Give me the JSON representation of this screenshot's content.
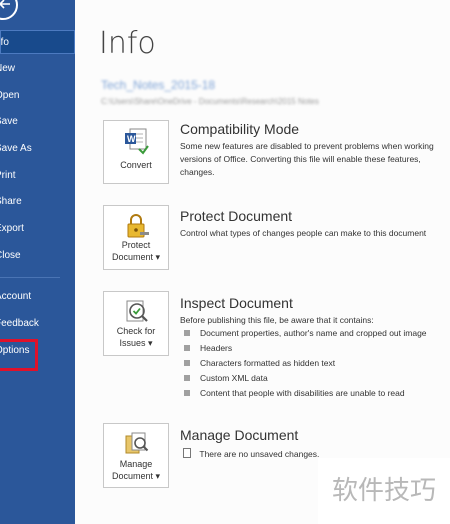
{
  "sidebar": {
    "items": [
      {
        "label": "nfo"
      },
      {
        "label": "New"
      },
      {
        "label": "Open"
      },
      {
        "label": "Save"
      },
      {
        "label": "Save As"
      },
      {
        "label": "Print"
      },
      {
        "label": "Share"
      },
      {
        "label": "Export"
      },
      {
        "label": "Close"
      },
      {
        "label": "Account"
      },
      {
        "label": "Feedback"
      },
      {
        "label": "Options"
      }
    ]
  },
  "main": {
    "title": "Info",
    "file_name": "Tech_Notes_2015-18",
    "file_path": "C:\\Users\\Share\\OneDrive - Documents\\Research\\2015 Notes",
    "sections": {
      "compatibility": {
        "button_label": "Convert",
        "title": "Compatibility Mode",
        "text_lines": [
          "Some new features are disabled to prevent problems when working",
          "versions of Office. Converting this file will enable these features,",
          "changes."
        ]
      },
      "protect": {
        "button_line1": "Protect",
        "button_line2": "Document",
        "title": "Protect Document",
        "text": "Control what types of changes people can make to this document"
      },
      "inspect": {
        "button_line1": "Check for",
        "button_line2": "Issues",
        "title": "Inspect Document",
        "intro": "Before publishing this file, be aware that it contains:",
        "bullets": [
          "Document properties, author's name and cropped out image",
          "Headers",
          "Characters formatted as hidden text",
          "Custom XML data",
          "Content that people with disabilities are unable to read"
        ]
      },
      "manage": {
        "button_line1": "Manage",
        "button_line2": "Document",
        "title": "Manage Document",
        "text": "There are no unsaved changes."
      }
    }
  },
  "watermark": "软件技巧",
  "colors": {
    "sidebar": "#2b579a",
    "highlight": "#e0112a"
  },
  "icons": [
    "back-arrow-icon",
    "word-convert-icon",
    "lock-key-icon",
    "inspect-checklist-icon",
    "manage-document-icon",
    "document-small-icon"
  ]
}
